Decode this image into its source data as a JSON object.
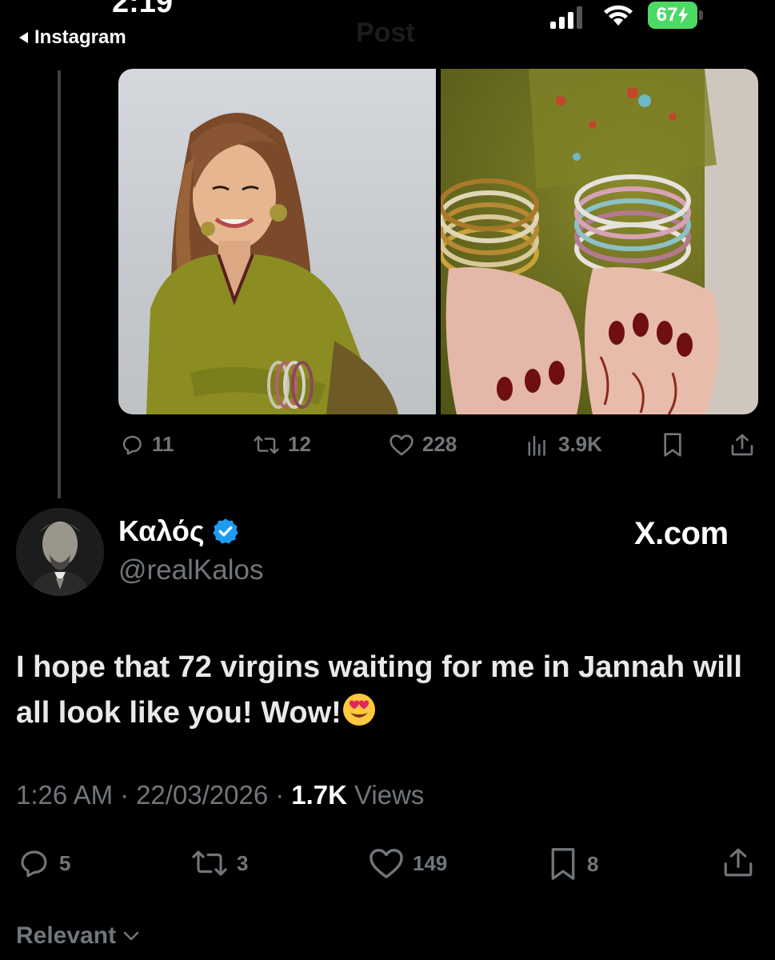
{
  "status_bar": {
    "time": "2:19",
    "back_label": "Instagram",
    "battery": "67"
  },
  "header": {
    "title": "Post"
  },
  "quoted_post": {
    "media": [
      {
        "icon": "woman-portrait-photo"
      },
      {
        "icon": "hands-henna-bangles-photo"
      }
    ],
    "stats": {
      "replies": "11",
      "reposts": "12",
      "likes": "228",
      "views": "3.9K"
    }
  },
  "reply": {
    "display_name": "Καλός",
    "handle": "@realKalos",
    "verified": true,
    "source": "X.com",
    "text": "I hope that 72 virgins waiting for me in Jannah will all look like you! Wow!",
    "emoji": "smiling-face-with-heart-eyes",
    "meta": {
      "time": "1:26 AM",
      "date": "22/03/2026",
      "views_count": "1.7K",
      "views_label": "Views"
    },
    "stats": {
      "replies": "5",
      "reposts": "3",
      "likes": "149",
      "bookmarks": "8"
    }
  },
  "sort": {
    "label": "Relevant"
  },
  "colors": {
    "background": "#000000",
    "muted": "#71767b",
    "verified": "#1d9bf0",
    "battery": "#4cd964"
  }
}
